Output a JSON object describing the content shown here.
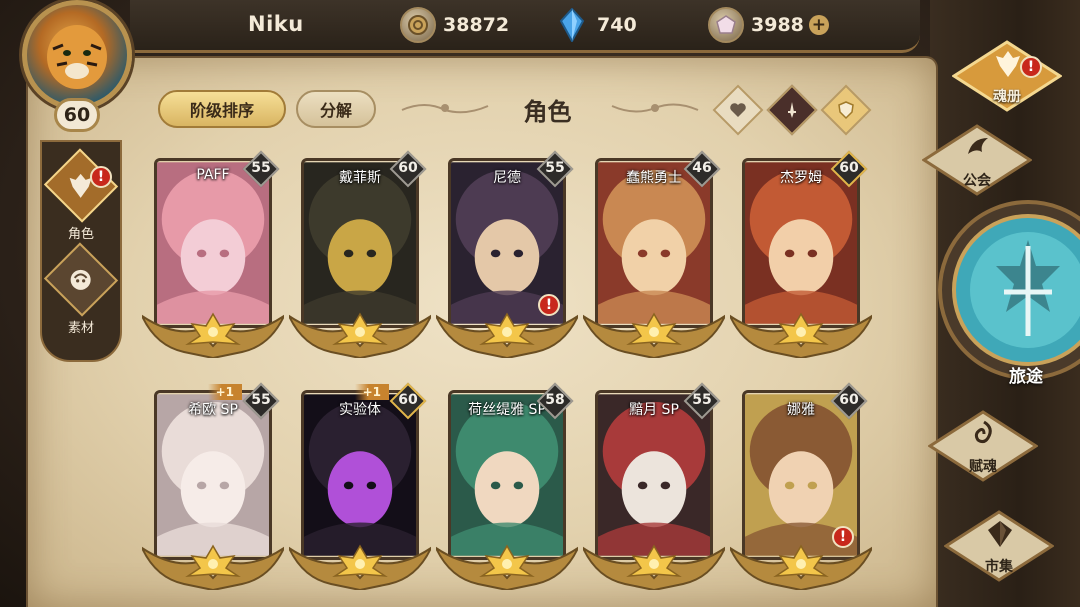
{
  "player": {
    "name": "Niku",
    "level": "60"
  },
  "resources": [
    {
      "icon": "gold-coin-icon",
      "value": "38872",
      "has_plus": false
    },
    {
      "icon": "blue-crystal-icon",
      "value": "740",
      "has_plus": false
    },
    {
      "icon": "gem-icon",
      "value": "3988",
      "has_plus": true
    }
  ],
  "side_nav": [
    {
      "label": "角色",
      "icon": "character-icon",
      "active": true,
      "alert": "!"
    },
    {
      "label": "素材",
      "icon": "material-icon",
      "active": false
    }
  ],
  "toolbar": {
    "sort_label": "阶级排序",
    "decompose_label": "分解",
    "title": "角色"
  },
  "filters": [
    {
      "icon": "heart-icon",
      "bg": "#e9dcc0"
    },
    {
      "icon": "sword-icon",
      "bg": "#4a2f2a"
    },
    {
      "icon": "shield-icon",
      "bg": "#e9c77a"
    }
  ],
  "heroes": [
    {
      "name": "PAFF",
      "level": "55",
      "plus": "",
      "gold": false,
      "alert": "",
      "art": [
        "#e79aa8",
        "#f3cdd6",
        "#b86e80"
      ]
    },
    {
      "name": "戴菲斯",
      "level": "60",
      "plus": "",
      "gold": false,
      "alert": "",
      "art": [
        "#3d3a2c",
        "#c9a646",
        "#28261f"
      ]
    },
    {
      "name": "尼德",
      "level": "55",
      "plus": "",
      "gold": false,
      "alert": "!",
      "art": [
        "#4d3b52",
        "#e4c8a8",
        "#2a2230"
      ]
    },
    {
      "name": "蠢熊勇士",
      "level": "46",
      "plus": "",
      "gold": false,
      "alert": "",
      "art": [
        "#c98852",
        "#f1d1a8",
        "#8a3a2a"
      ]
    },
    {
      "name": "杰罗姆",
      "level": "60",
      "plus": "",
      "gold": true,
      "alert": "",
      "art": [
        "#c25a34",
        "#f2cfa9",
        "#7a3022"
      ]
    },
    {
      "name": "希欧 SP",
      "level": "55",
      "plus": "+1",
      "gold": false,
      "alert": "",
      "art": [
        "#e9dcd8",
        "#f6ece8",
        "#b7a6a6"
      ]
    },
    {
      "name": "实验体",
      "level": "60",
      "plus": "+1",
      "gold": true,
      "alert": "",
      "art": [
        "#2a2030",
        "#b050d8",
        "#130e18"
      ]
    },
    {
      "name": "荷丝缇雅 SP",
      "level": "58",
      "plus": "",
      "gold": false,
      "alert": "",
      "art": [
        "#3e8a6e",
        "#f0d8c0",
        "#2b5a4a"
      ]
    },
    {
      "name": "黯月 SP",
      "level": "55",
      "plus": "",
      "gold": false,
      "alert": "",
      "art": [
        "#a83a3a",
        "#ece4dc",
        "#3a2828"
      ]
    },
    {
      "name": "娜雅",
      "level": "60",
      "plus": "",
      "gold": false,
      "alert": "!",
      "art": [
        "#8a5a34",
        "#f0d2b2",
        "#c0a050"
      ]
    }
  ],
  "right_nav": [
    {
      "label": "魂册",
      "icon": "soul-book-icon",
      "active": true,
      "alert": "!"
    },
    {
      "label": "公会",
      "icon": "guild-icon",
      "active": false
    },
    {
      "label": "旅途",
      "icon": "journey-icon"
    },
    {
      "label": "赋魂",
      "icon": "soul-infuse-icon",
      "active": false
    },
    {
      "label": "市集",
      "icon": "market-icon",
      "active": false
    }
  ]
}
